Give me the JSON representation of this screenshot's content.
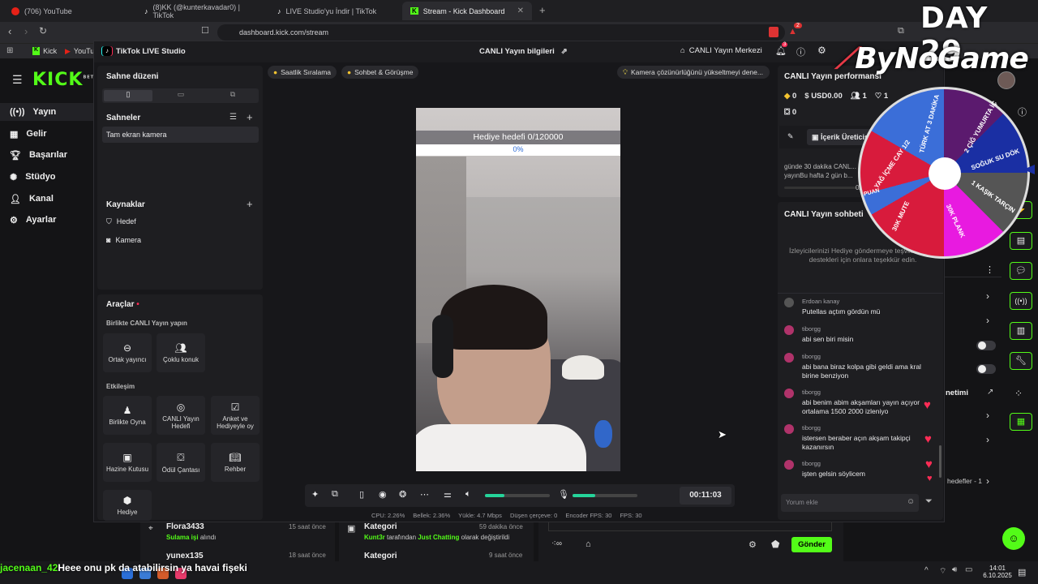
{
  "browser": {
    "tabs": [
      {
        "label": "(706) YouTube"
      },
      {
        "label": "(8)KK (@kunterkavadar0) | TikTok"
      },
      {
        "label": "LIVE Studio'yu İndir | TikTok"
      },
      {
        "label": "Stream - Kick Dashboard"
      }
    ],
    "url": "dashboard.kick.com/stream",
    "bookmarks": [
      "Kick",
      "YouTu"
    ],
    "extension_badge": "2"
  },
  "overlay": {
    "day": "DAY 29",
    "brand": "ByNoGame"
  },
  "kick": {
    "logo": "KICK",
    "logo_sup": "BETA",
    "nav": [
      "Yayın",
      "Gelir",
      "Başarılar",
      "Stüdyo",
      "Kanal",
      "Ayarlar"
    ],
    "right_labels": {
      "management": "netimi",
      "goals": "hedefler - 1"
    },
    "bottom": {
      "events": [
        {
          "user": "Flora3433",
          "time": "15 saat önce",
          "action": "Sulama işi",
          "suffix": "alındı"
        },
        {
          "user": "yunex135",
          "time": "18 saat önce"
        }
      ],
      "categories": [
        {
          "title": "Kategori",
          "time": "59 dakika önce",
          "user": "Kunt3r",
          "text": "tarafından",
          "category": "Just Chatting",
          "suffix": "olarak değiştirildi"
        },
        {
          "title": "Kategori",
          "time": "9 saat önce"
        }
      ],
      "send_label": "Gönder"
    }
  },
  "ticker": {
    "user": "jacenaan_42",
    "text": "Heee onu pk da atabilirsin ya havai fişeki"
  },
  "taskbar": {
    "time": "14:01",
    "date": "6.10.2025"
  },
  "studio": {
    "app_title": "TikTok LIVE Studio",
    "header_center": "CANLI Yayın bilgileri",
    "header_right": "CANLI Yayın Merkezi",
    "notif_badge": "3",
    "scene_layout": "Sahne düzeni",
    "scenes_title": "Sahneler",
    "scenes": [
      "Tam ekran kamera"
    ],
    "sources_title": "Kaynaklar",
    "sources": [
      "Hedef",
      "Kamera"
    ],
    "tools_title": "Araçlar",
    "collab_title": "Birlikte CANLI Yayın yapın",
    "collab_tools": [
      "Ortak yayıncı",
      "Çoklu konuk"
    ],
    "engage_title": "Etkileşim",
    "engage_tools": [
      "Birlikte Oyna",
      "CANLI Yayın Hedefi",
      "Anket ve Hediyeyle oy",
      "Hazine Kutusu",
      "Ödül Çantası",
      "Rehber",
      "Hediye"
    ],
    "chips": [
      "Saatlik Sıralama",
      "Sohbet & Görüşme"
    ],
    "camera_tip": "Kamera çözünürlüğünü yükseltmeyi dene...",
    "gift_goal": {
      "label": "Hediye hedefi",
      "current": 0,
      "target": 120000,
      "text": "0/120000",
      "percent": "0%"
    },
    "timer": "00:11:03",
    "volume_level": 0.3,
    "mic_level": 0.35,
    "stats": {
      "cpu": "CPU: 2.26%",
      "memory": "Bellek: 2.36%",
      "upload": "Yükle: 4.7 Mbps",
      "dropped": "Düşen çerçeve: 0",
      "encoder": "Encoder FPS: 30",
      "fps": "FPS: 30"
    },
    "performance": {
      "title": "CANLI Yayın performansı",
      "diamonds": "0",
      "usd": "USD0.00",
      "viewers": "1",
      "likes": "1",
      "gifts": "0",
      "creator_btn": "İçerik Üreticisi",
      "tip": "günde 30 dakika CANL... yayınBu hafta 2 gün b...",
      "tip_count": "0/"
    },
    "chat": {
      "title": "CANLI Yayın sohbeti",
      "empty_hint": "İzleyicilerinizi Hediye göndermeye teşvik edin ve destekleri için onlara teşekkür edin.",
      "messages": [
        {
          "user": "Erdoan kanay",
          "text": "Putellas açtım gördün mü"
        },
        {
          "user": "tiborgg",
          "text": "abi sen biri misin"
        },
        {
          "user": "tiborgg",
          "text": "abi bana biraz kolpa gibi geldi ama kral birine benziyon"
        },
        {
          "user": "tiborgg",
          "text": "abi benim abim akşamları yayın açıyor ortalama 1500 2000 izleniyo"
        },
        {
          "user": "tiborgg",
          "text": "istersen beraber açın akşam takipçi kazanırsın"
        },
        {
          "user": "tiborgg",
          "text": "işten gelsin söylicem"
        }
      ],
      "input_placeholder": "Yorum ekle"
    }
  },
  "wheel": {
    "segments": [
      "2 ÇİĞ YUMURTA İÇ",
      "SOĞUK SU DÖK",
      "1 KAŞIK TARÇIN",
      "30K PLANK",
      "30K MUTE",
      "YAĞ İÇME CAY 1/2",
      "TÜRK AT 3 DAKİKA",
      "PUAN"
    ]
  }
}
